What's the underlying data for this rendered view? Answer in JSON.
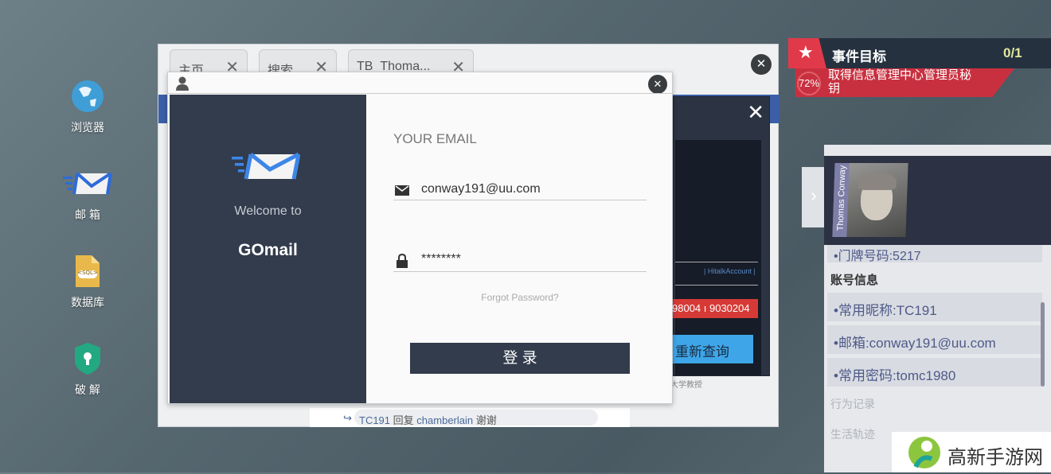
{
  "desktop": {
    "icons": [
      {
        "label": "浏览器",
        "icon": "globe-icon"
      },
      {
        "label": "邮 箱",
        "icon": "mail-icon"
      },
      {
        "label": "数据库",
        "icon": "sql-file-icon",
        "badge": "<SQL>"
      },
      {
        "label": "破 解",
        "icon": "shield-key-icon"
      }
    ]
  },
  "browser": {
    "tabs": [
      {
        "label": "主页"
      },
      {
        "label": "搜索"
      },
      {
        "label": "TB_Thoma..."
      }
    ],
    "close": "✕",
    "background_panel": {
      "column_label": "| HitalkAccount |",
      "numbers": "98004 ı 9030204",
      "requery_button": "重新查询",
      "footer_text": "大学教授"
    },
    "comment": {
      "user": "TC191",
      "action": "回复",
      "target": "chamberlain",
      "text": "谢谢"
    }
  },
  "mail_login": {
    "welcome": "Welcome to",
    "app_name": "GOmail",
    "email_label": "YOUR EMAIL",
    "email_value": "conway191@uu.com",
    "password_value": "********",
    "forgot": "Forgot Password?",
    "login_button": "登 录"
  },
  "quest": {
    "title": "事件目标",
    "count": "0/1",
    "progress": "72%",
    "progress_value": 0.72,
    "description": "取得信息管理中心管理员秘钥",
    "accent": "#e03a4a"
  },
  "profile": {
    "name": "Thomas Conway",
    "partial_row": "•门牌号码:5217",
    "section": "账号信息",
    "rows": [
      "•常用昵称:TC191",
      "•邮箱:conway191@uu.com",
      "•常用密码:tomc1980"
    ],
    "faded": [
      "行为记录",
      "生活轨迹"
    ]
  },
  "watermark": {
    "site": "高新手游网"
  }
}
